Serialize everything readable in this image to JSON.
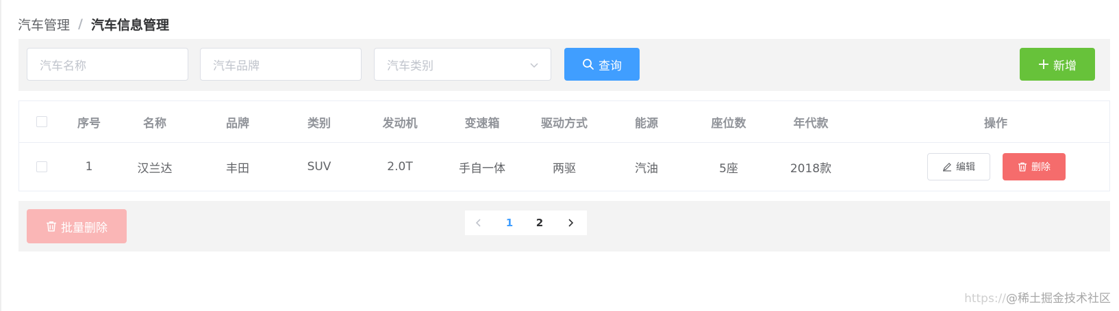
{
  "breadcrumb": {
    "parent": "汽车管理",
    "separator": "/",
    "current": "汽车信息管理"
  },
  "search": {
    "name_placeholder": "汽车名称",
    "brand_placeholder": "汽车品牌",
    "type_placeholder": "汽车类别",
    "query_label": "查询",
    "add_label": "新增"
  },
  "table": {
    "columns": [
      "序号",
      "名称",
      "品牌",
      "类别",
      "发动机",
      "变速箱",
      "驱动方式",
      "能源",
      "座位数",
      "年代款",
      "操作"
    ],
    "rows": [
      {
        "index": "1",
        "name": "汉兰达",
        "brand": "丰田",
        "type": "SUV",
        "engine": "2.0T",
        "gearbox": "手自一体",
        "drive": "两驱",
        "energy": "汽油",
        "seats": "5座",
        "model_year": "2018款",
        "edit_label": "编辑",
        "delete_label": "删除"
      }
    ]
  },
  "footer": {
    "batch_delete_label": "批量删除",
    "pages": [
      "1",
      "2"
    ],
    "current_page": "1"
  },
  "watermark": {
    "prefix": "https://",
    "text": "@稀土掘金技术社区"
  },
  "colors": {
    "primary": "#409eff",
    "success": "#67c23a",
    "danger": "#f56c6c",
    "danger_light": "#fab6b6",
    "bar_bg": "#f3f3f3"
  },
  "icons": [
    "search-icon",
    "plus-icon",
    "chevron-down-icon",
    "edit-icon",
    "trash-icon",
    "chevron-left-icon",
    "chevron-right-icon"
  ]
}
